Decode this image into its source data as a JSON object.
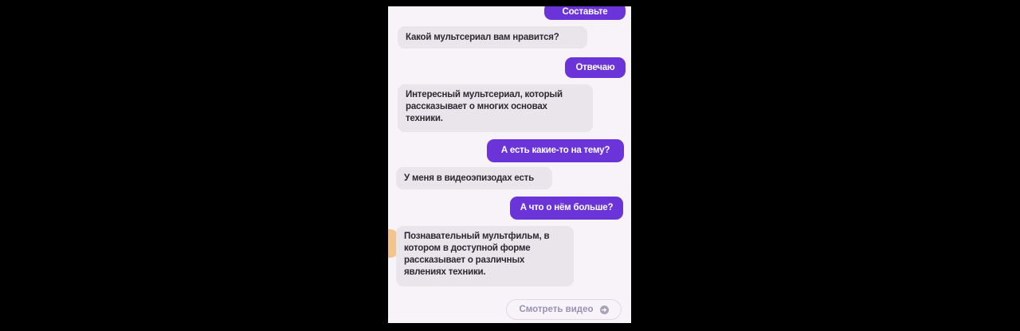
{
  "chat": {
    "messages": [
      {
        "role": "user",
        "text": "Составьте"
      },
      {
        "role": "bot",
        "text": "Какой мультсериал вам нравится?"
      },
      {
        "role": "user",
        "text": "Отвечаю"
      },
      {
        "role": "bot",
        "text": "Интересный мультсериал, который рассказывает о многих основах техники."
      },
      {
        "role": "user",
        "text": "А есть какие-то на тему?"
      },
      {
        "role": "bot",
        "text": "У меня в видеоэпизодах есть"
      },
      {
        "role": "user",
        "text": "А что о нём больше?"
      },
      {
        "role": "bot",
        "text": "Познавательный мультфильм, в котором в доступной форме рассказывает о различных явлениях техники."
      }
    ],
    "action_button": {
      "label": "Смотреть видео",
      "icon": "arrow-circle-icon"
    }
  },
  "colors": {
    "background": "#000000",
    "screen": "#f7f3f8",
    "bot_bubble": "#e9e5ea",
    "user_bubble": "#6a34d8",
    "accent": "#f2b56a"
  }
}
